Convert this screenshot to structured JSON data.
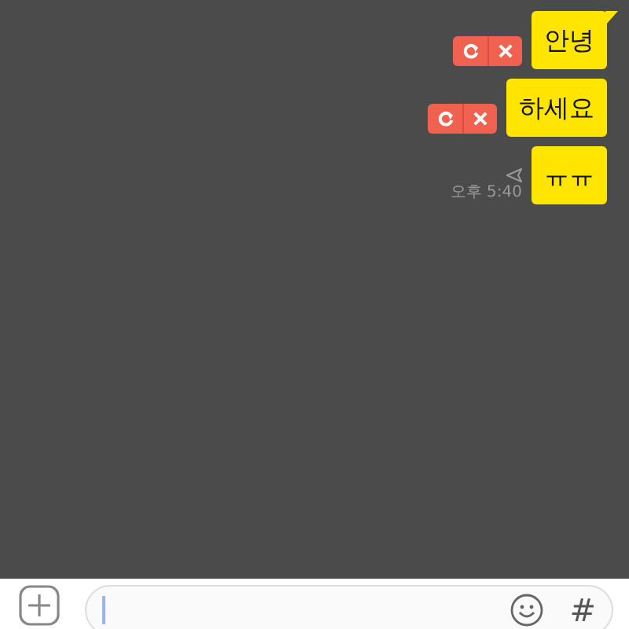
{
  "messages": [
    {
      "text": "안녕",
      "failed": true,
      "tail": true
    },
    {
      "text": "하세요",
      "failed": true,
      "tail": false
    },
    {
      "text": "ㅠㅠ",
      "failed": false,
      "tail": false,
      "time": "오후 5:40"
    }
  ],
  "composer": {
    "focused": true,
    "hash_key": "#"
  }
}
